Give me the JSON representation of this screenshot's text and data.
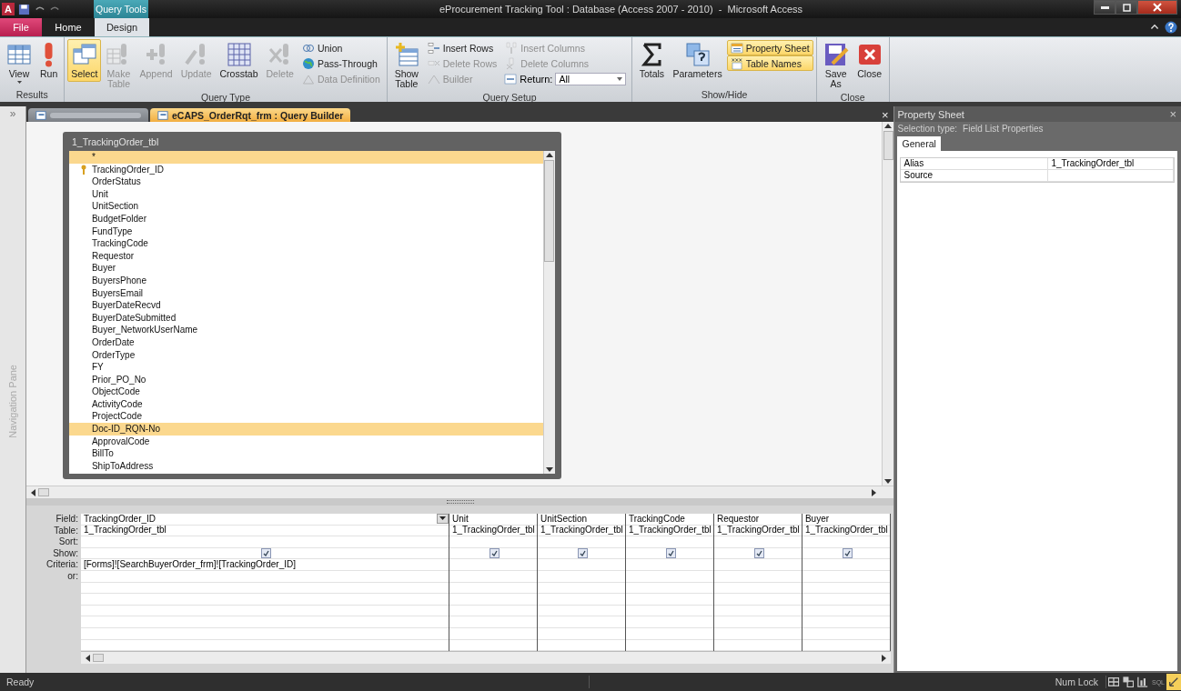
{
  "window": {
    "app_logo": "A",
    "contextual_tab": "Query Tools",
    "title": "eProcurement Tracking Tool : Database (Access 2007 - 2010)  -  Microsoft Access"
  },
  "ribbon_tabs": [
    {
      "label": "File",
      "kind": "file",
      "selected": false
    },
    {
      "label": "Home",
      "kind": "normal",
      "selected": false
    },
    {
      "label": "Design",
      "kind": "normal",
      "selected": true
    }
  ],
  "ribbon_groups": [
    {
      "label": "Results",
      "items": [
        {
          "label": "View",
          "kind": "large",
          "disabled": false,
          "selected": false,
          "menu": true
        },
        {
          "label": "Run",
          "kind": "large",
          "disabled": false,
          "selected": false,
          "menu": false
        }
      ]
    },
    {
      "label": "Query Type",
      "items": [
        {
          "label": "Select",
          "kind": "large",
          "disabled": false,
          "selected": true
        },
        {
          "label": "Make Table",
          "kind": "large",
          "disabled": true,
          "selected": false
        },
        {
          "label": "Append",
          "kind": "large",
          "disabled": true,
          "selected": false
        },
        {
          "label": "Update",
          "kind": "large",
          "disabled": true,
          "selected": false
        },
        {
          "label": "Crosstab",
          "kind": "large",
          "disabled": false,
          "selected": false
        },
        {
          "label": "Delete",
          "kind": "large",
          "disabled": true,
          "selected": false
        },
        {
          "label": "Union",
          "kind": "small",
          "disabled": false,
          "selected": false
        },
        {
          "label": "Pass-Through",
          "kind": "small",
          "disabled": false,
          "selected": false
        },
        {
          "label": "Data Definition",
          "kind": "small",
          "disabled": true,
          "selected": false
        }
      ]
    },
    {
      "label": "Query Setup",
      "items": [
        {
          "label": "Show Table",
          "kind": "large",
          "disabled": false,
          "selected": false
        },
        {
          "label": "Insert Rows",
          "kind": "small",
          "disabled": false,
          "selected": false
        },
        {
          "label": "Delete Rows",
          "kind": "small",
          "disabled": true,
          "selected": false
        },
        {
          "label": "Builder",
          "kind": "small",
          "disabled": true,
          "selected": false
        },
        {
          "label": "Insert Columns",
          "kind": "small",
          "disabled": true,
          "selected": false
        },
        {
          "label": "Delete Columns",
          "kind": "small",
          "disabled": true,
          "selected": false
        },
        {
          "label": "Return:",
          "kind": "dropdown",
          "value": "All"
        }
      ]
    },
    {
      "label": "Show/Hide",
      "items": [
        {
          "label": "Totals",
          "kind": "large",
          "disabled": false,
          "selected": false
        },
        {
          "label": "Parameters",
          "kind": "large",
          "disabled": false,
          "selected": false
        },
        {
          "label": "Property Sheet",
          "kind": "small",
          "disabled": false,
          "selected": true
        },
        {
          "label": "Table Names",
          "kind": "small",
          "disabled": false,
          "selected": true
        }
      ]
    },
    {
      "label": "Close",
      "items": [
        {
          "label": "Save As",
          "kind": "large",
          "disabled": false,
          "selected": false
        },
        {
          "label": "Close",
          "kind": "large",
          "disabled": false,
          "selected": false
        }
      ]
    }
  ],
  "navigation_pane": {
    "toggle": "»",
    "label": "Navigation Pane"
  },
  "doc_tabs": [
    {
      "selected": false
    },
    {
      "label": "eCAPS_OrderRqt_frm : Query Builder",
      "selected": true
    }
  ],
  "doc_close": "×",
  "field_list": {
    "title": "1_TrackingOrder_tbl",
    "fields": [
      {
        "name": "*",
        "primary_key": false,
        "selected": true
      },
      {
        "name": "TrackingOrder_ID",
        "primary_key": true,
        "selected": false
      },
      {
        "name": "OrderStatus",
        "primary_key": false,
        "selected": false
      },
      {
        "name": "Unit",
        "primary_key": false,
        "selected": false
      },
      {
        "name": "UnitSection",
        "primary_key": false,
        "selected": false
      },
      {
        "name": "BudgetFolder",
        "primary_key": false,
        "selected": false
      },
      {
        "name": "FundType",
        "primary_key": false,
        "selected": false
      },
      {
        "name": "TrackingCode",
        "primary_key": false,
        "selected": false
      },
      {
        "name": "Requestor",
        "primary_key": false,
        "selected": false
      },
      {
        "name": "Buyer",
        "primary_key": false,
        "selected": false
      },
      {
        "name": "BuyersPhone",
        "primary_key": false,
        "selected": false
      },
      {
        "name": "BuyersEmail",
        "primary_key": false,
        "selected": false
      },
      {
        "name": "BuyerDateRecvd",
        "primary_key": false,
        "selected": false
      },
      {
        "name": "BuyerDateSubmitted",
        "primary_key": false,
        "selected": false
      },
      {
        "name": "Buyer_NetworkUserName",
        "primary_key": false,
        "selected": false
      },
      {
        "name": "OrderDate",
        "primary_key": false,
        "selected": false
      },
      {
        "name": "OrderType",
        "primary_key": false,
        "selected": false
      },
      {
        "name": "FY",
        "primary_key": false,
        "selected": false
      },
      {
        "name": "Prior_PO_No",
        "primary_key": false,
        "selected": false
      },
      {
        "name": "ObjectCode",
        "primary_key": false,
        "selected": false
      },
      {
        "name": "ActivityCode",
        "primary_key": false,
        "selected": false
      },
      {
        "name": "ProjectCode",
        "primary_key": false,
        "selected": false
      },
      {
        "name": "Doc-ID_RQN-No",
        "primary_key": false,
        "selected": true
      },
      {
        "name": "ApprovalCode",
        "primary_key": false,
        "selected": false
      },
      {
        "name": "BillTo",
        "primary_key": false,
        "selected": false
      },
      {
        "name": "ShipToAddress",
        "primary_key": false,
        "selected": false
      }
    ]
  },
  "grid": {
    "row_labels": [
      "Field:",
      "Table:",
      "Sort:",
      "Show:",
      "Criteria:",
      "or:"
    ],
    "columns": [
      {
        "field": "TrackingOrder_ID",
        "table": "1_TrackingOrder_tbl",
        "show": true,
        "focused": true,
        "criteria": "[Forms]![SearchBuyerOrder_frm]![TrackingOrder_ID]"
      },
      {
        "field": "Unit",
        "table": "1_TrackingOrder_tbl",
        "show": true,
        "focused": false
      },
      {
        "field": "UnitSection",
        "table": "1_TrackingOrder_tbl",
        "show": true,
        "focused": false
      },
      {
        "field": "TrackingCode",
        "table": "1_TrackingOrder_tbl",
        "show": true,
        "focused": false
      },
      {
        "field": "Requestor",
        "table": "1_TrackingOrder_tbl",
        "show": true,
        "focused": false
      },
      {
        "field": "Buyer",
        "table": "1_TrackingOrder_tbl",
        "show": true,
        "focused": false
      }
    ]
  },
  "property_sheet": {
    "title": "Property Sheet",
    "close": "×",
    "selection_label": "Selection type:",
    "selection_type": "Field List Properties",
    "tabs": [
      {
        "label": "General",
        "selected": true
      }
    ],
    "properties": [
      {
        "name": "Alias",
        "value": "1_TrackingOrder_tbl"
      },
      {
        "name": "Source"
      }
    ]
  },
  "status_bar": {
    "text": "Ready",
    "indicator": "Num Lock",
    "views": [
      {
        "kind": "datasheet",
        "selected": false
      },
      {
        "kind": "pivottable",
        "selected": false
      },
      {
        "kind": "pivotchart",
        "selected": false
      },
      {
        "kind": "sql",
        "label": "SQL",
        "selected": false
      },
      {
        "kind": "design",
        "selected": true
      }
    ]
  }
}
